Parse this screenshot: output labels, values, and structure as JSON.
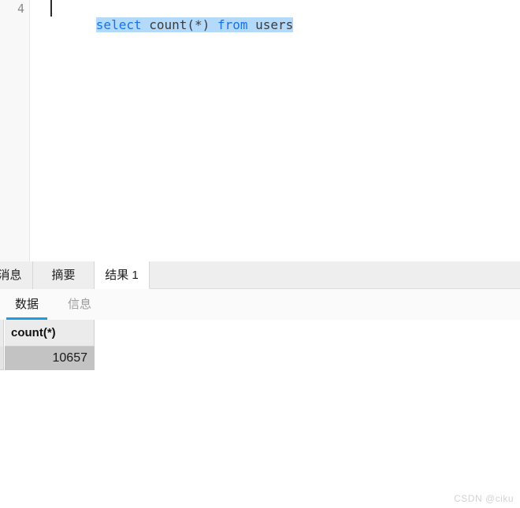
{
  "editor": {
    "line_number": "4",
    "sql_tokens": [
      {
        "text": "select",
        "type": "keyword"
      },
      {
        "text": " ",
        "type": "plain"
      },
      {
        "text": "count(*)",
        "type": "plain"
      },
      {
        "text": " ",
        "type": "plain"
      },
      {
        "text": "from",
        "type": "keyword"
      },
      {
        "text": " ",
        "type": "plain"
      },
      {
        "text": "users",
        "type": "plain"
      }
    ],
    "sql_text": "select count(*) from users",
    "selection_highlight_color": "#b3d9fb",
    "keyword_color": "#1673e8",
    "plain_color": "#3c3c3c"
  },
  "result_panel": {
    "tabs": [
      {
        "label": "消息",
        "active": false
      },
      {
        "label": "摘要",
        "active": false
      },
      {
        "label": "结果 1",
        "active": true
      }
    ],
    "sub_tabs": [
      {
        "label": "数据",
        "active": true
      },
      {
        "label": "信息",
        "active": false
      }
    ],
    "accent_color": "#1a9ee0",
    "grid": {
      "columns": [
        "count(*)"
      ],
      "rows": [
        [
          "10657"
        ]
      ],
      "selected_cell_color": "#c3c3c3"
    }
  },
  "watermark": {
    "text": "CSDN @ciku"
  }
}
